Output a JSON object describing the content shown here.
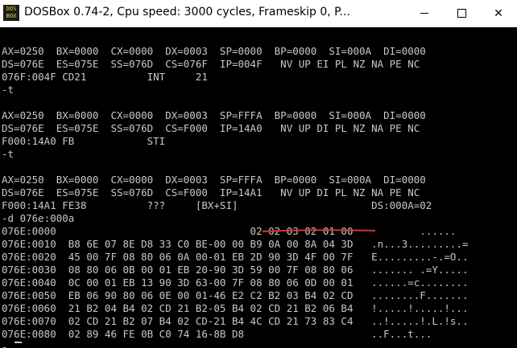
{
  "window": {
    "title": "DOSBox 0.74-2, Cpu speed:     3000 cycles, Frameskip  0, P...",
    "icon_text": "DOS BOX",
    "minimize_label": "",
    "maximize_label": "",
    "close_label": "✕"
  },
  "console": {
    "lines": [
      "",
      "AX=0250  BX=0000  CX=0000  DX=0003  SP=0000  BP=0000  SI=000A  DI=0000",
      "DS=076E  ES=075E  SS=076D  CS=076F  IP=004F   NV UP EI PL NZ NA PE NC",
      "076F:004F CD21          INT     21",
      "-t",
      "",
      "AX=0250  BX=0000  CX=0000  DX=0003  SP=FFFA  BP=0000  SI=000A  DI=0000",
      "DS=076E  ES=075E  SS=076D  CS=F000  IP=14A0   NV UP DI PL NZ NA PE NC",
      "F000:14A0 FB            STI",
      "-t",
      "",
      "AX=0250  BX=0000  CX=0000  DX=0003  SP=FFFA  BP=0000  SI=000A  DI=0000",
      "DS=076E  ES=075E  SS=076D  CS=F000  IP=14A1   NV UP DI PL NZ NA PE NC",
      "F000:14A1 FE38          ???     [BX+SI]                      DS:000A=02",
      "-d 076e:000a",
      "076E:0000                                02 02 03 02 01 00           ......",
      "076E:0010  B8 6E 07 8E D8 33 C0 BE-00 00 B9 0A 00 8A 04 3D   .n...3.........=",
      "076E:0020  45 00 7F 08 80 06 0A 00-01 EB 2D 90 3D 4F 00 7F   E.........-.=O..",
      "076E:0030  08 80 06 0B 00 01 EB 20-90 3D 59 00 7F 08 80 06   ....... .=Y.....",
      "076E:0040  0C 00 01 EB 13 90 3D 63-00 7F 08 80 06 0D 00 01   ......=c........",
      "076E:0050  EB 06 90 80 06 0E 00 01-46 E2 C2 B2 03 B4 02 CD   ........F.......",
      "076E:0060  21 B2 04 B4 02 CD 21 B2-05 B4 02 CD 21 B2 06 B4   !.....!.....!...",
      "076E:0070  02 CD 21 B2 07 B4 02 CD-21 B4 4C CD 21 73 83 C4   ..!.....!.L.!s..",
      "076E:0080  02 89 46 FE 0B C0 74 16-8B D8                     ..F...t...",
      "-"
    ]
  },
  "annotation": {
    "color": "#e03030"
  }
}
